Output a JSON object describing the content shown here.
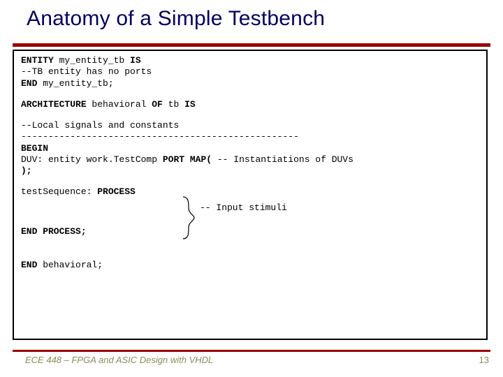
{
  "title": "Anatomy of a Simple Testbench",
  "code": {
    "l1_kw1": "ENTITY",
    "l1_id": " my_entity_tb ",
    "l1_kw2": "IS",
    "l2": "        --TB entity has no ports",
    "l3_kw": "END",
    "l3_rest": " my_entity_tb;",
    "l4_kw1": "ARCHITECTURE",
    "l4_mid": " behavioral ",
    "l4_kw2": "OF",
    "l4_mid2": " tb ",
    "l4_kw3": "IS",
    "l5": "    --Local signals and constants",
    "dashes": "---------------------------------------------------",
    "l6_kw": "BEGIN",
    "l7_pre": "  DUV: entity work.TestComp ",
    "l7_kw": "PORT MAP",
    "l7_open": "(",
    "l7_cmt": "          -- Instantiations of DUVs",
    "l8": "                       );",
    "l9_pre": "  testSequence: ",
    "l9_kw": "PROCESS",
    "stimuli": "-- Input stimuli",
    "l10_kw": "  END PROCESS;",
    "l11_kw1": "END",
    "l11_rest": " behavioral;"
  },
  "footer": {
    "left": "ECE 448 – FPGA and ASIC Design with VHDL",
    "page": "13"
  }
}
